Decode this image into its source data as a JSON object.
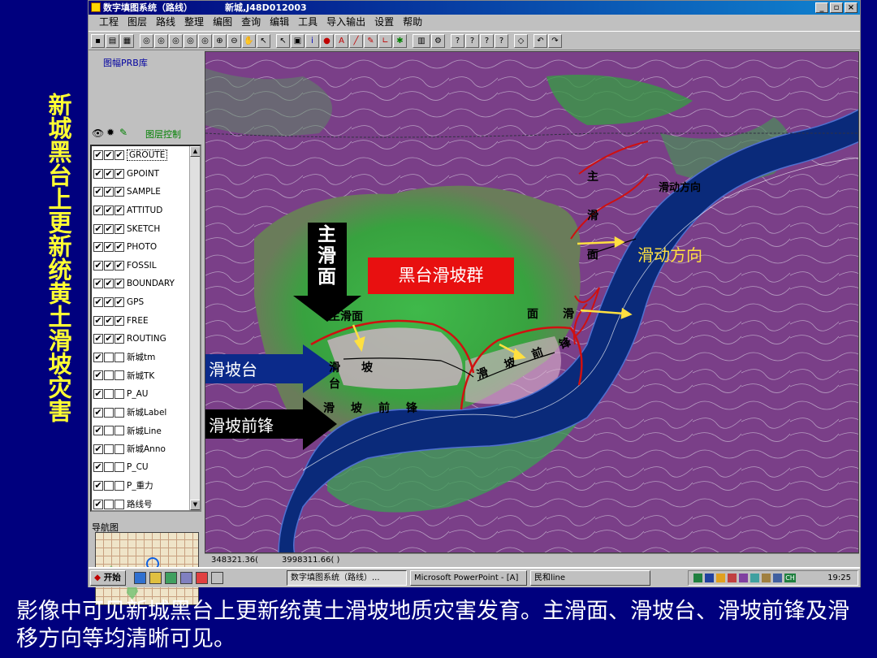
{
  "side_title": "新城黑台上更新统黄土滑坡灾害",
  "caption": "影像中可见新城黑台上更新统黄土滑坡地质灾害发育。主滑面、滑坡台、滑坡前锋及滑移方向等均清晰可见。",
  "window": {
    "title": "数字填图系统（路线）",
    "document": "新城,J48D012003",
    "controls": [
      "_",
      "▫",
      "×"
    ]
  },
  "menu": [
    "工程",
    "图层",
    "路线",
    "整理",
    "编图",
    "查询",
    "编辑",
    "工具",
    "导入输出",
    "设置",
    "帮助"
  ],
  "left_panel": {
    "library_label": "图幅PRB库",
    "layer_control_label": "图层控制",
    "layers": [
      {
        "name": "GROUTE",
        "checks": 3,
        "selected": true
      },
      {
        "name": "GPOINT",
        "checks": 3
      },
      {
        "name": "SAMPLE",
        "checks": 3
      },
      {
        "name": "ATTITUD",
        "checks": 3
      },
      {
        "name": "SKETCH",
        "checks": 3
      },
      {
        "name": "PHOTO",
        "checks": 3
      },
      {
        "name": "FOSSIL",
        "checks": 3
      },
      {
        "name": "BOUNDARY",
        "checks": 3
      },
      {
        "name": "GPS",
        "checks": 3
      },
      {
        "name": "FREE",
        "checks": 3
      },
      {
        "name": "ROUTING",
        "checks": 3
      },
      {
        "name": "新城tm",
        "checks": 1
      },
      {
        "name": "新城TK",
        "checks": 1
      },
      {
        "name": "P_AU",
        "checks": 1
      },
      {
        "name": "新城Label",
        "checks": 1
      },
      {
        "name": "新城Line",
        "checks": 1
      },
      {
        "name": "新城Anno",
        "checks": 1
      },
      {
        "name": "P_CU",
        "checks": 1
      },
      {
        "name": "P_重力",
        "checks": 1
      },
      {
        "name": "路线号",
        "checks": 1
      }
    ],
    "nav_label": "导航图"
  },
  "map_labels": {
    "main_slip_surface_big": "主滑面",
    "landslide_group": "黑台滑坡群",
    "landslide_terrace": "滑坡台",
    "landslide_front": "滑坡前锋",
    "slide_direction_1": "滑动方向",
    "slide_direction_2": "滑动方向",
    "main_slip_surface_small": "主滑面",
    "small_main_slip_right": "主滑面",
    "slip_terrace_small": "滑坡台",
    "slip_front_small": "滑坡前锋",
    "slip_front_right": "滑坡前锋",
    "slip_right": "面滑"
  },
  "status": {
    "x": "348321.36(",
    "y": "3998311.66( )"
  },
  "taskbar": {
    "start": "开始",
    "tasks": [
      {
        "label": "数字填图系统（路线）...",
        "active": true
      },
      {
        "label": "Microsoft PowerPoint - [A]"
      },
      {
        "label": "民和line"
      }
    ],
    "clock": "19:25",
    "ime": "CH"
  },
  "colors": {
    "background": "#00007e",
    "side_title": "#ffff33",
    "caption": "#ffffff",
    "label_box": "#e81010",
    "arrow_blue": "#0b2a8a",
    "slip_line": "#d01010",
    "river": "#0a2a7a",
    "vegetation": "#3aa840"
  }
}
